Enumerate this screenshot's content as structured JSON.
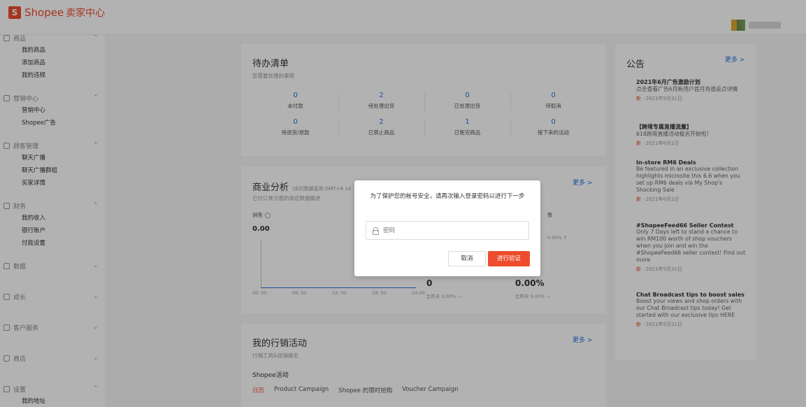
{
  "brand": {
    "name": "Shopee",
    "subtitle": "卖家中心"
  },
  "sidebar": {
    "groups": [
      {
        "label": "商品",
        "icon": "product-icon",
        "expanded": true,
        "items": [
          "我的商品",
          "添加商品",
          "我的违规"
        ]
      },
      {
        "label": "营销中心",
        "icon": "marketing-icon",
        "expanded": true,
        "items": [
          "营销中心",
          "Shopee广告"
        ]
      },
      {
        "label": "顾客管理",
        "icon": "customer-icon",
        "expanded": true,
        "items": [
          "聊天广播",
          "聊天广播群组",
          "买家详情"
        ]
      },
      {
        "label": "财务",
        "icon": "finance-icon",
        "expanded": true,
        "items": [
          "我的收入",
          "银行账户",
          "付款设置"
        ]
      },
      {
        "label": "数据",
        "icon": "data-icon",
        "expanded": false,
        "items": []
      },
      {
        "label": "成长",
        "icon": "growth-icon",
        "expanded": false,
        "items": []
      },
      {
        "label": "客户服务",
        "icon": "service-icon",
        "expanded": false,
        "items": []
      },
      {
        "label": "商店",
        "icon": "shop-icon",
        "expanded": false,
        "items": []
      },
      {
        "label": "设置",
        "icon": "settings-icon",
        "expanded": true,
        "items": [
          "我的地址"
        ]
      }
    ]
  },
  "todo": {
    "title": "待办清单",
    "subtitle": "您需要处理的事情",
    "row1": [
      {
        "value": "0",
        "label": "未付款"
      },
      {
        "value": "2",
        "label": "待处理出货"
      },
      {
        "value": "0",
        "label": "已处理出货"
      },
      {
        "value": "0",
        "label": "待取消"
      }
    ],
    "row2": [
      {
        "value": "0",
        "label": "待退货/退款"
      },
      {
        "value": "2",
        "label": "已禁止商品"
      },
      {
        "value": "1",
        "label": "已售完商品"
      },
      {
        "value": "0",
        "label": "接下来的活动"
      }
    ]
  },
  "analytics": {
    "title": "商业分析",
    "note": "(实时数据直到 GMT+8 14",
    "subtitle": "已付订单方面的商店数据概述",
    "more": "更多 >",
    "sales_label": "销售",
    "sales_value": "0.00",
    "x_ticks": [
      "00: 00",
      "06: 00",
      "12: 00",
      "18: 00",
      "24:00"
    ],
    "metric_a_value": "0",
    "metric_a_cmp": "比昨天 0.00% —",
    "metric_b_value": "0.00%",
    "metric_b_cmp": "比昨天 0.00% —",
    "metric_c_label": "数",
    "metric_c_change": "0.00%"
  },
  "marketing": {
    "title": "我的行销活动",
    "subtitle": "行销工具&促销报名",
    "more": "更多 >",
    "section": "Shopee活动",
    "tabs": [
      "日历",
      "Product Campaign",
      "Shopee 的限时抢购",
      "Voucher Campaign"
    ]
  },
  "announcements": {
    "title": "公告",
    "more": "更多 >",
    "items": [
      {
        "title": "2021年6月广告激励计划",
        "body": "点击查看广告6月新用户首月充值返点详情",
        "badge": "新",
        "date": "· 2021年5月31日"
      },
      {
        "title": "【跨境专属直播流量】",
        "body": "618跨境直播活动报名开始啦！",
        "badge": "新",
        "date": "· 2021年6月1日"
      },
      {
        "title": "In-store RM6 Deals",
        "body": "Be featured in an exclusive collection highlights microsite this 6.6 when you set up RM6 deals via My Shop's Shocking Sale",
        "badge": "新",
        "date": "· 2021年6月1日"
      },
      {
        "title": "#ShopeeFeed66 Seller Contest",
        "body": "Only 7 Days left to stand a chance to win RM100 worth of shop vouchers when you join and win the #ShopeeFeed66 seller contest! Find out more",
        "badge": "新",
        "date": "· 2021年5月31日"
      },
      {
        "title": "Chat Broadcast tips to boost sales",
        "body": "Boost your views and shop orders with our Chat Broadcast tips today! Get started with our exclusive tips HERE",
        "badge": "新",
        "date": "· 2021年5月31日"
      }
    ]
  },
  "dialog": {
    "message": "为了保护您的帐号安全，请再次输入登录密码以进行下一步",
    "password_placeholder": "密码",
    "cancel": "取消",
    "verify": "进行验证"
  },
  "colors": {
    "brand": "#ee4d2d",
    "link": "#2673dd"
  }
}
